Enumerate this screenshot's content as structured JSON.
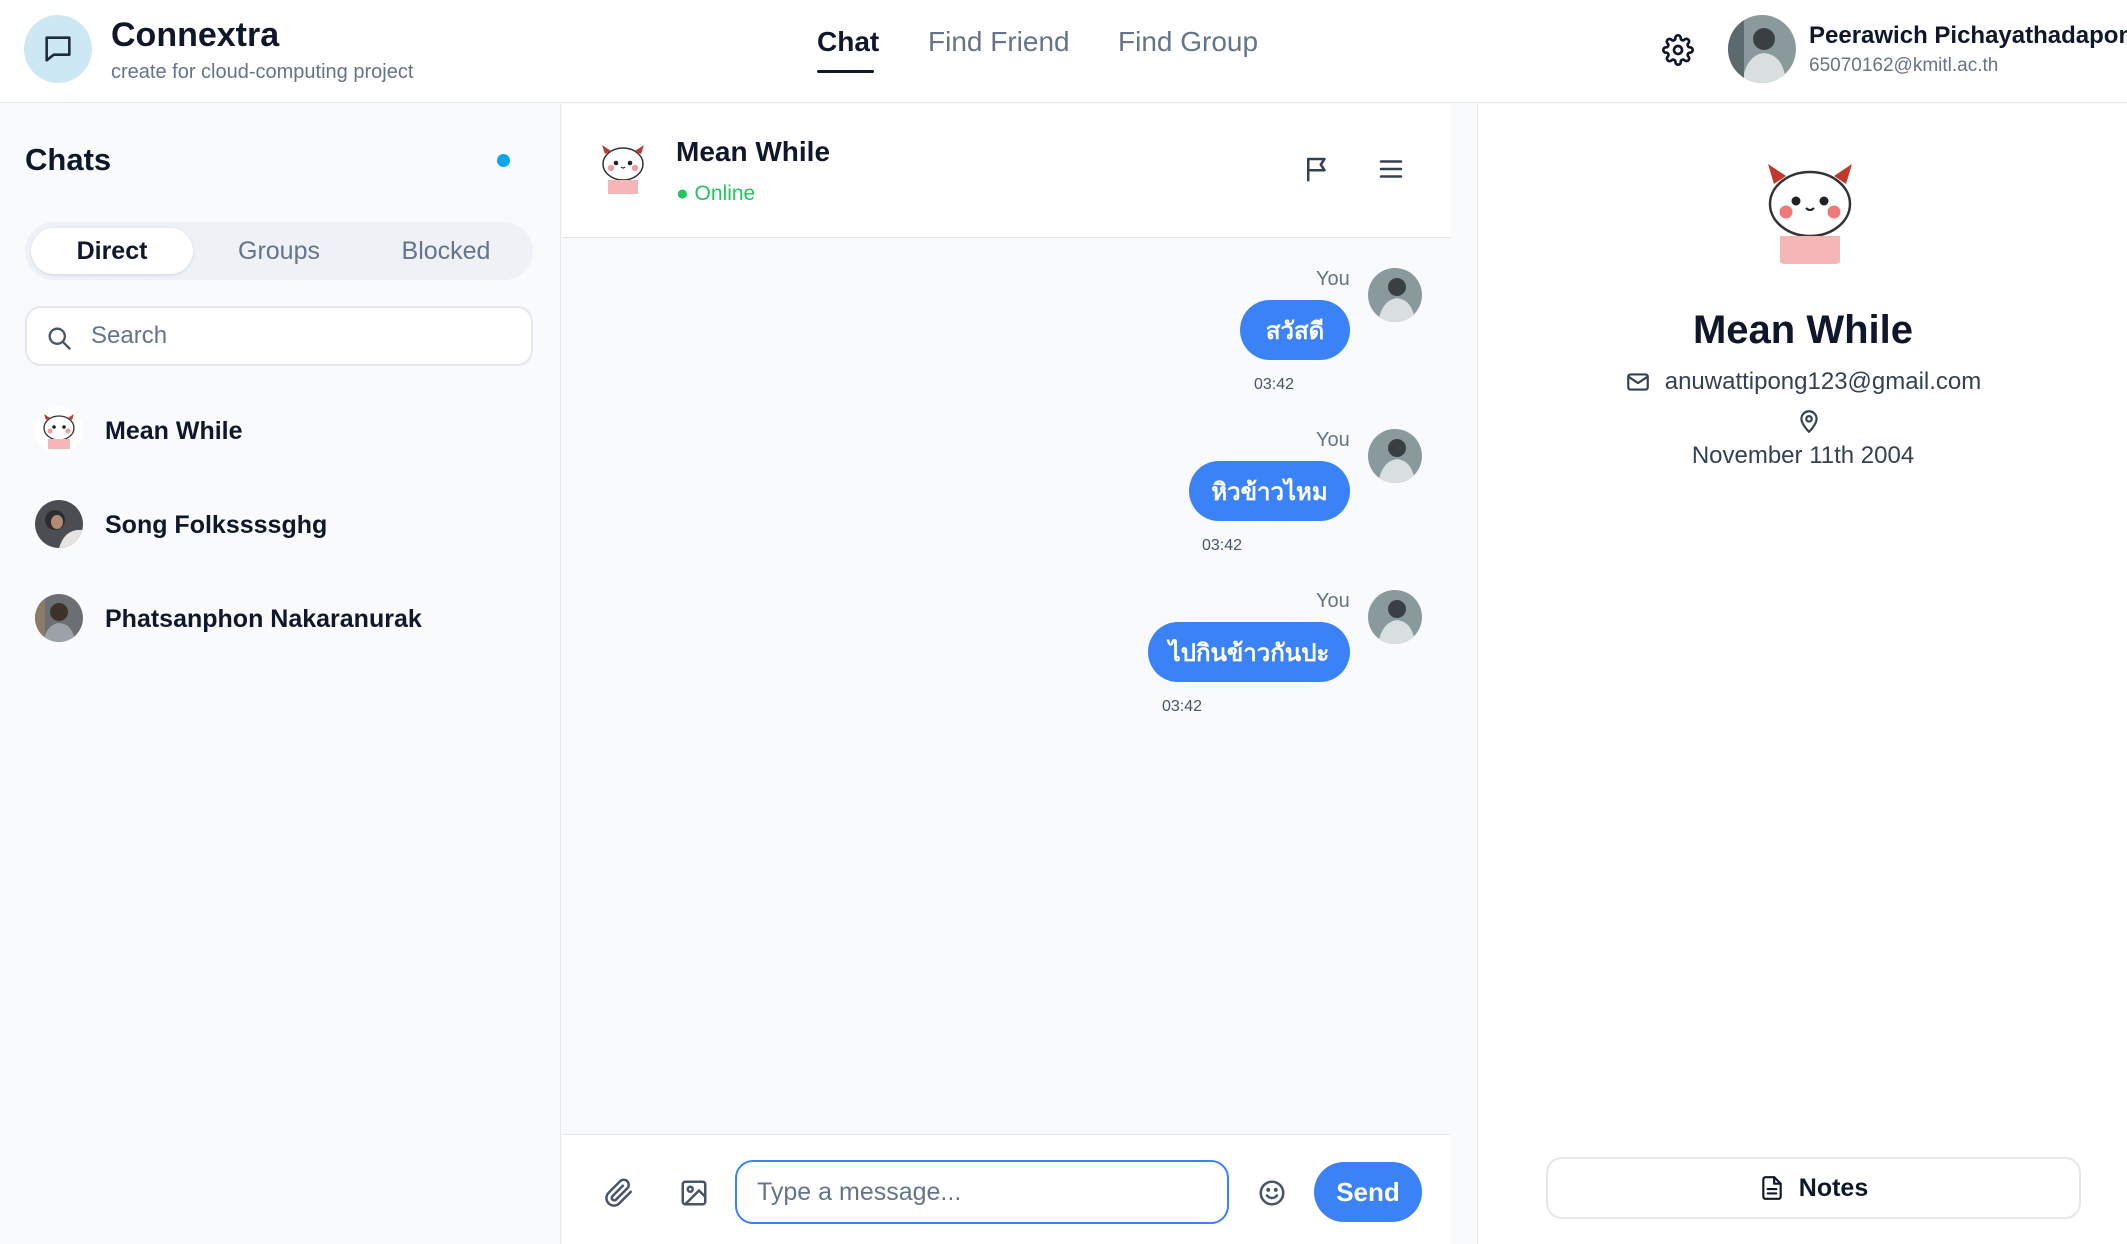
{
  "app": {
    "title": "Connextra",
    "subtitle": "create for cloud-computing project",
    "logo_icon": "message-square-icon",
    "accent_color": "#3b82f6"
  },
  "nav": {
    "items": [
      {
        "label": "Chat",
        "active": true
      },
      {
        "label": "Find Friend",
        "active": false
      },
      {
        "label": "Find Group",
        "active": false
      }
    ]
  },
  "user": {
    "name": "Peerawich Pichayathadapong",
    "email": "65070162@kmitl.ac.th"
  },
  "sidebar": {
    "title": "Chats",
    "tabs": [
      {
        "label": "Direct",
        "active": true
      },
      {
        "label": "Groups",
        "active": false
      },
      {
        "label": "Blocked",
        "active": false
      }
    ],
    "search_placeholder": "Search",
    "chats": [
      {
        "name": "Mean While"
      },
      {
        "name": "Song Folkssssghg"
      },
      {
        "name": "Phatsanphon Nakaranurak"
      }
    ]
  },
  "chat": {
    "contact_name": "Mean While",
    "status": "● Online",
    "messages": [
      {
        "sender": "You",
        "text": "สวัสดี",
        "time": "03:42"
      },
      {
        "sender": "You",
        "text": "หิวข้าวไหม",
        "time": "03:42"
      },
      {
        "sender": "You",
        "text": "ไปกินข้าวกันปะ",
        "time": "03:42"
      }
    ],
    "input_placeholder": "Type a message...",
    "send_label": "Send"
  },
  "profile": {
    "name": "Mean While",
    "email": "anuwattipong123@gmail.com",
    "birthday": "November 11th 2004",
    "notes_label": "Notes"
  }
}
